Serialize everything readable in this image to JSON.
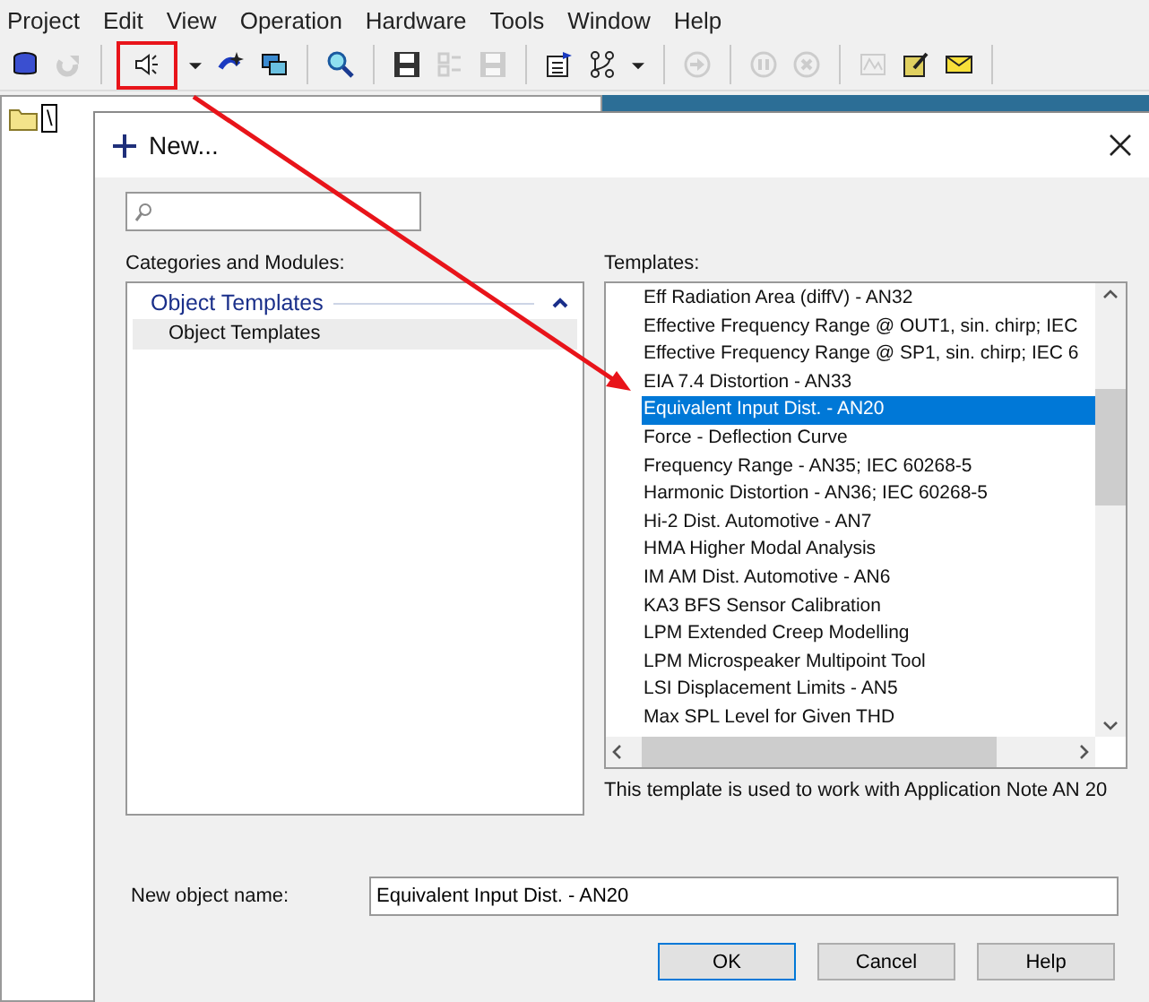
{
  "menu": [
    "Project",
    "Edit",
    "View",
    "Operation",
    "Hardware",
    "Tools",
    "Window",
    "Help"
  ],
  "toolbar": [
    {
      "kind": "database",
      "disabled": false,
      "highlighted": false
    },
    {
      "kind": "redo",
      "disabled": true,
      "highlighted": false
    },
    {
      "kind": "sep"
    },
    {
      "kind": "speaker",
      "disabled": false,
      "highlighted": true
    },
    {
      "kind": "caret",
      "disabled": false,
      "highlighted": false
    },
    {
      "kind": "spark",
      "disabled": false,
      "highlighted": false
    },
    {
      "kind": "monitors",
      "disabled": false,
      "highlighted": false
    },
    {
      "kind": "sep"
    },
    {
      "kind": "search",
      "disabled": false,
      "highlighted": false
    },
    {
      "kind": "sep"
    },
    {
      "kind": "save",
      "disabled": false,
      "highlighted": false
    },
    {
      "kind": "merge",
      "disabled": true,
      "highlighted": false
    },
    {
      "kind": "save",
      "disabled": true,
      "highlighted": false
    },
    {
      "kind": "sep"
    },
    {
      "kind": "properties",
      "disabled": false,
      "highlighted": false
    },
    {
      "kind": "branch",
      "disabled": false,
      "highlighted": false
    },
    {
      "kind": "caret",
      "disabled": false,
      "highlighted": false
    },
    {
      "kind": "sep"
    },
    {
      "kind": "forward",
      "disabled": true,
      "highlighted": false
    },
    {
      "kind": "sep"
    },
    {
      "kind": "pause",
      "disabled": true,
      "highlighted": false
    },
    {
      "kind": "stop",
      "disabled": true,
      "highlighted": false
    },
    {
      "kind": "sep"
    },
    {
      "kind": "chart",
      "disabled": true,
      "highlighted": false
    },
    {
      "kind": "notepad",
      "disabled": false,
      "highlighted": false
    },
    {
      "kind": "mail",
      "disabled": false,
      "highlighted": false
    },
    {
      "kind": "sep"
    }
  ],
  "tree": {
    "root_label": "\\"
  },
  "dialog": {
    "title": "New...",
    "categories_label": "Categories and Modules:",
    "categories": [
      {
        "group": "Object Templates",
        "expanded": true,
        "items": [
          {
            "label": "Object Templates",
            "selected": true
          }
        ]
      }
    ],
    "templates_label": "Templates:",
    "templates": [
      {
        "label": "Eff Radiation Area (diffV) - AN32",
        "selected": false
      },
      {
        "label": "Effective Frequency Range @ OUT1, sin. chirp; IEC",
        "selected": false
      },
      {
        "label": "Effective Frequency Range @ SP1, sin. chirp; IEC 6",
        "selected": false
      },
      {
        "label": "EIA 7.4 Distortion - AN33",
        "selected": false
      },
      {
        "label": "Equivalent Input Dist. - AN20",
        "selected": true
      },
      {
        "label": "Force - Deflection Curve",
        "selected": false
      },
      {
        "label": "Frequency Range - AN35; IEC 60268-5",
        "selected": false
      },
      {
        "label": "Harmonic Distortion - AN36; IEC 60268-5",
        "selected": false
      },
      {
        "label": "Hi-2 Dist. Automotive - AN7",
        "selected": false
      },
      {
        "label": "HMA Higher Modal Analysis",
        "selected": false
      },
      {
        "label": "IM AM Dist. Automotive - AN6",
        "selected": false
      },
      {
        "label": "KA3 BFS Sensor Calibration",
        "selected": false
      },
      {
        "label": "LPM Extended Creep Modelling",
        "selected": false
      },
      {
        "label": "LPM Microspeaker Multipoint Tool",
        "selected": false
      },
      {
        "label": "LSI Displacement Limits - AN5",
        "selected": false
      },
      {
        "label": "Max SPL Level for Given THD",
        "selected": false
      }
    ],
    "description": "This template is used to work with Application Note AN 20",
    "name_label": "New object name:",
    "name_value": "Equivalent Input Dist. - AN20",
    "buttons": [
      "OK",
      "Cancel",
      "Help"
    ]
  }
}
